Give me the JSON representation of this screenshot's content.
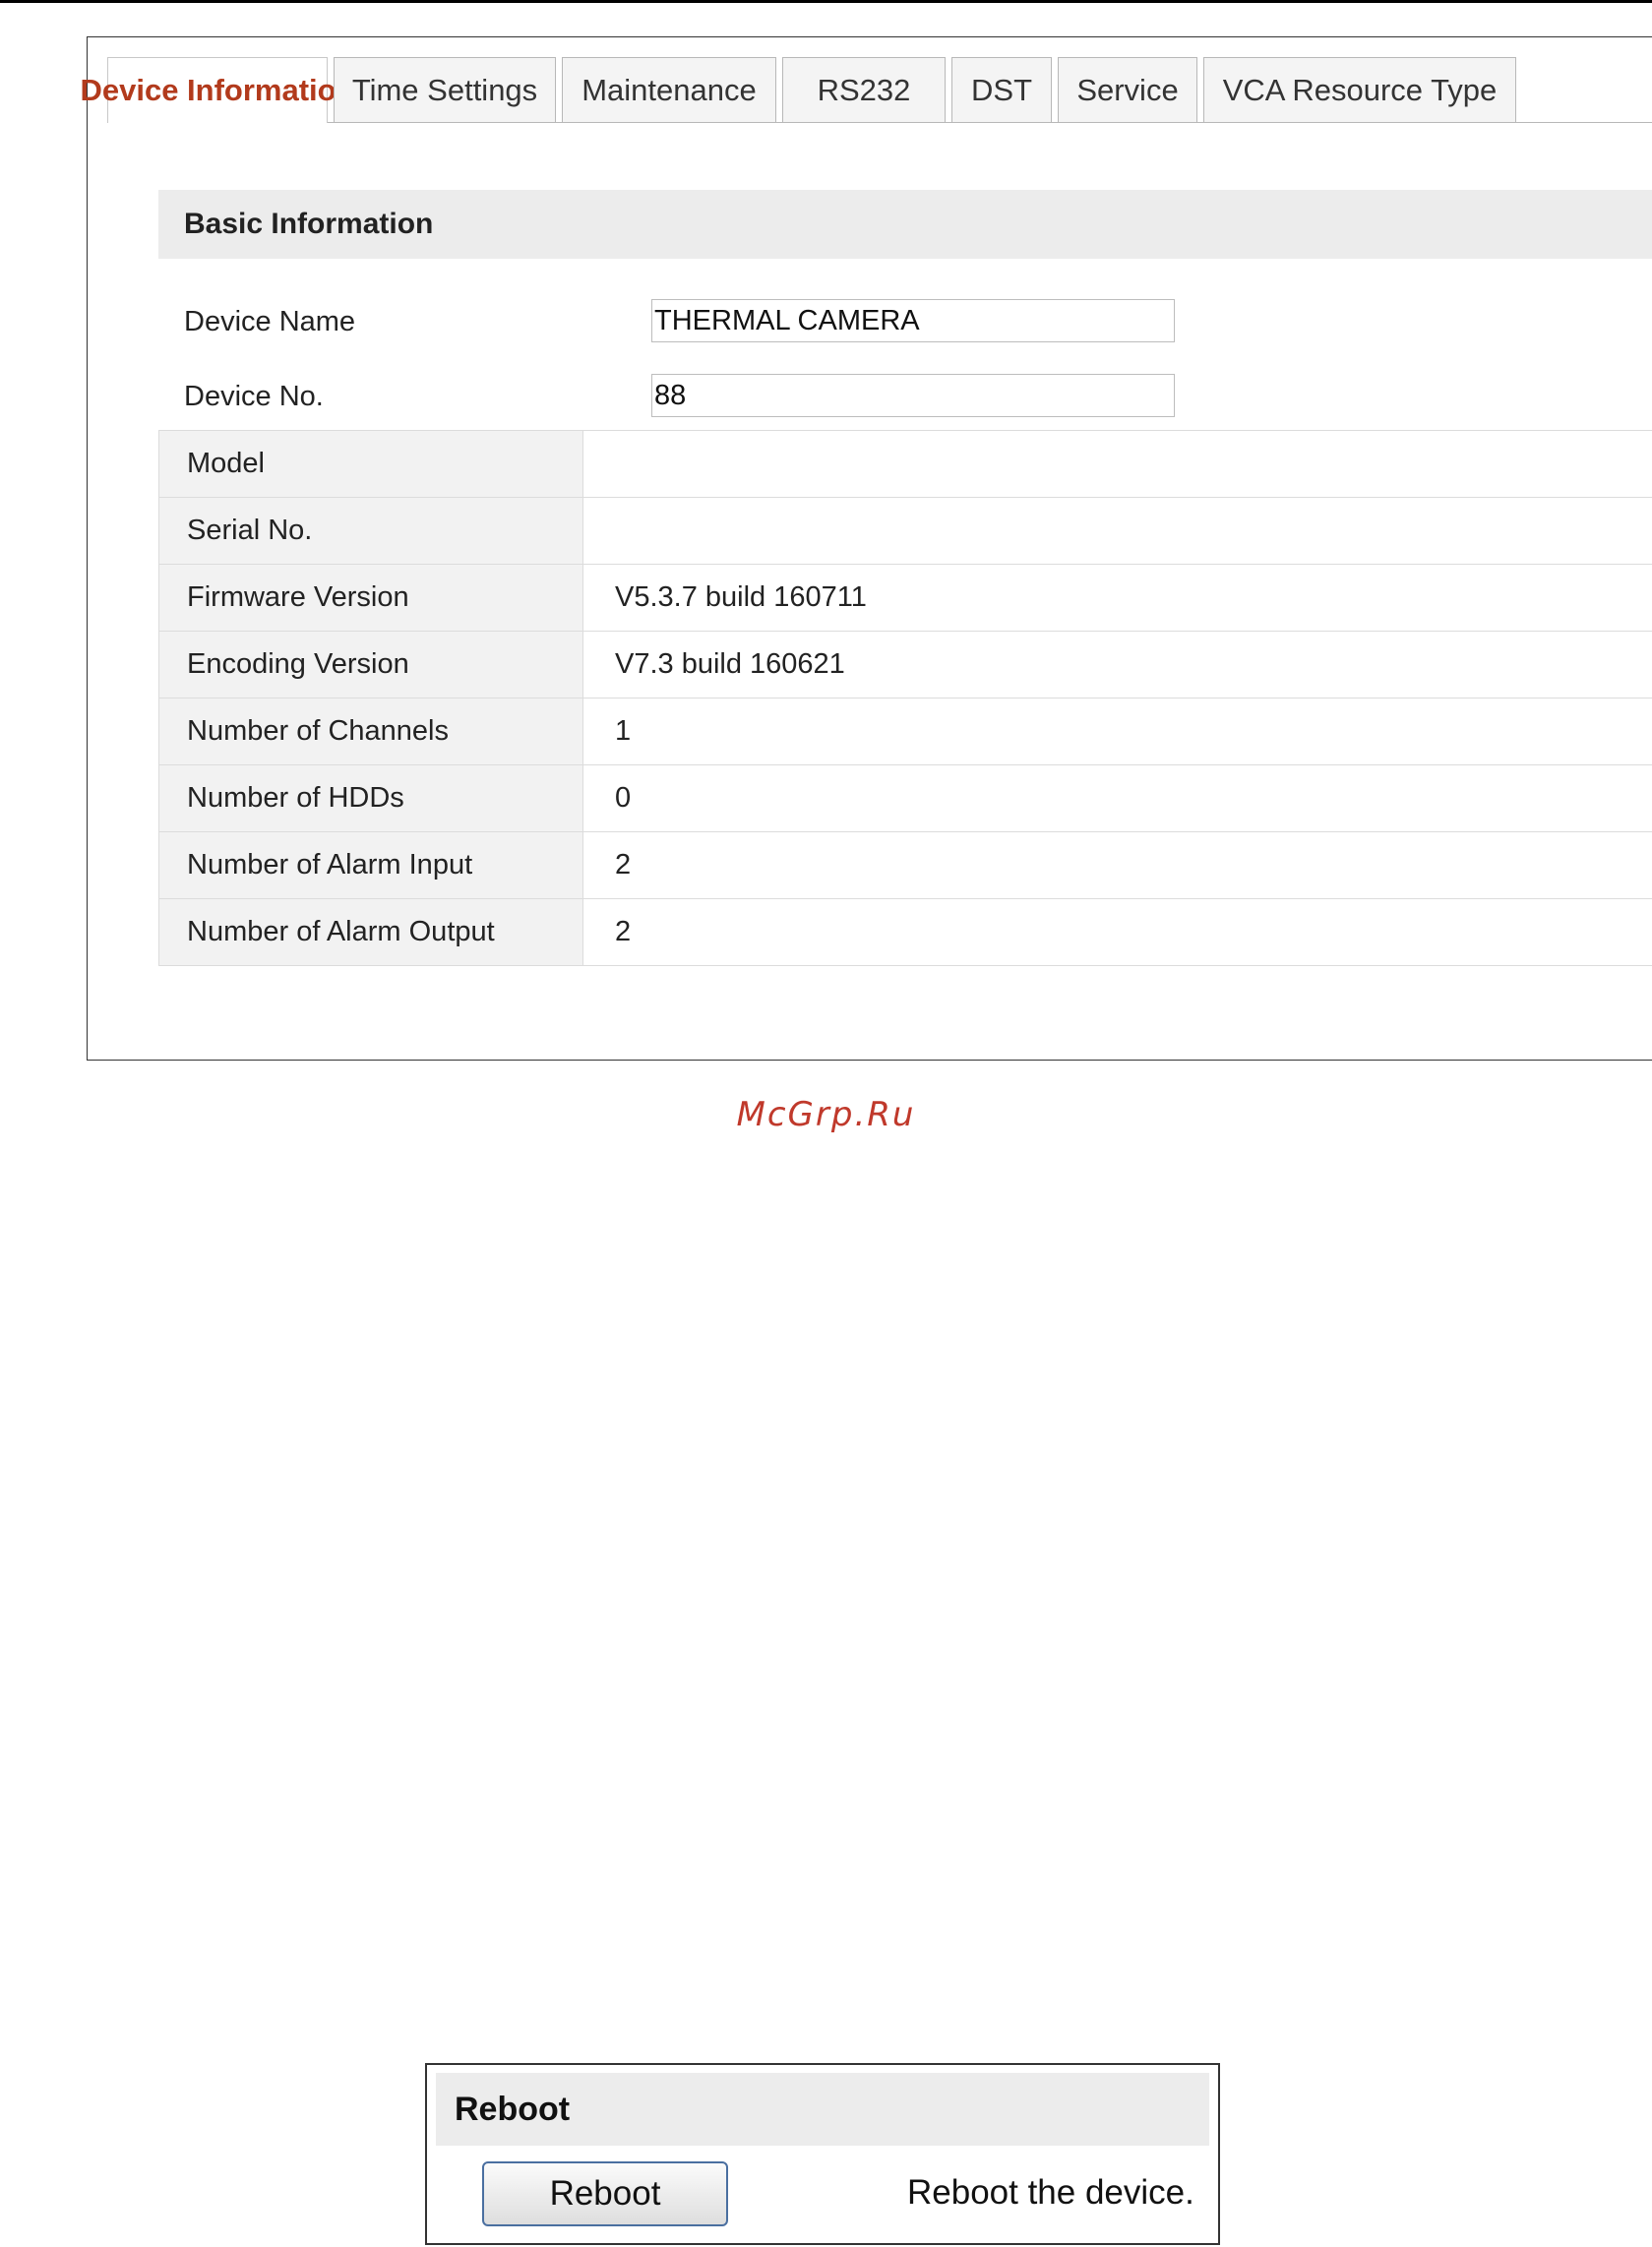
{
  "tabs": [
    {
      "label": "Device Information",
      "active": true
    },
    {
      "label": "Time Settings",
      "active": false
    },
    {
      "label": "Maintenance",
      "active": false
    },
    {
      "label": "RS232",
      "active": false
    },
    {
      "label": "DST",
      "active": false
    },
    {
      "label": "Service",
      "active": false
    },
    {
      "label": "VCA Resource Type",
      "active": false
    }
  ],
  "basic": {
    "title": "Basic Information",
    "device_name": {
      "label": "Device Name",
      "value": "THERMAL CAMERA"
    },
    "device_no": {
      "label": "Device No.",
      "value": "88"
    }
  },
  "info": [
    {
      "label": "Model",
      "value": ""
    },
    {
      "label": "Serial No.",
      "value": ""
    },
    {
      "label": "Firmware Version",
      "value": "V5.3.7 build 160711"
    },
    {
      "label": "Encoding Version",
      "value": "V7.3 build 160621"
    },
    {
      "label": "Number of Channels",
      "value": "1"
    },
    {
      "label": "Number of HDDs",
      "value": "0"
    },
    {
      "label": "Number of Alarm Input",
      "value": "2"
    },
    {
      "label": "Number of Alarm Output",
      "value": "2"
    }
  ],
  "watermark": "McGrp.Ru",
  "reboot": {
    "title": "Reboot",
    "button_label": "Reboot",
    "description": "Reboot the device."
  },
  "colors": {
    "active_tab": "#b23a1c",
    "header_bg": "#ececec",
    "watermark": "#c0392b"
  }
}
